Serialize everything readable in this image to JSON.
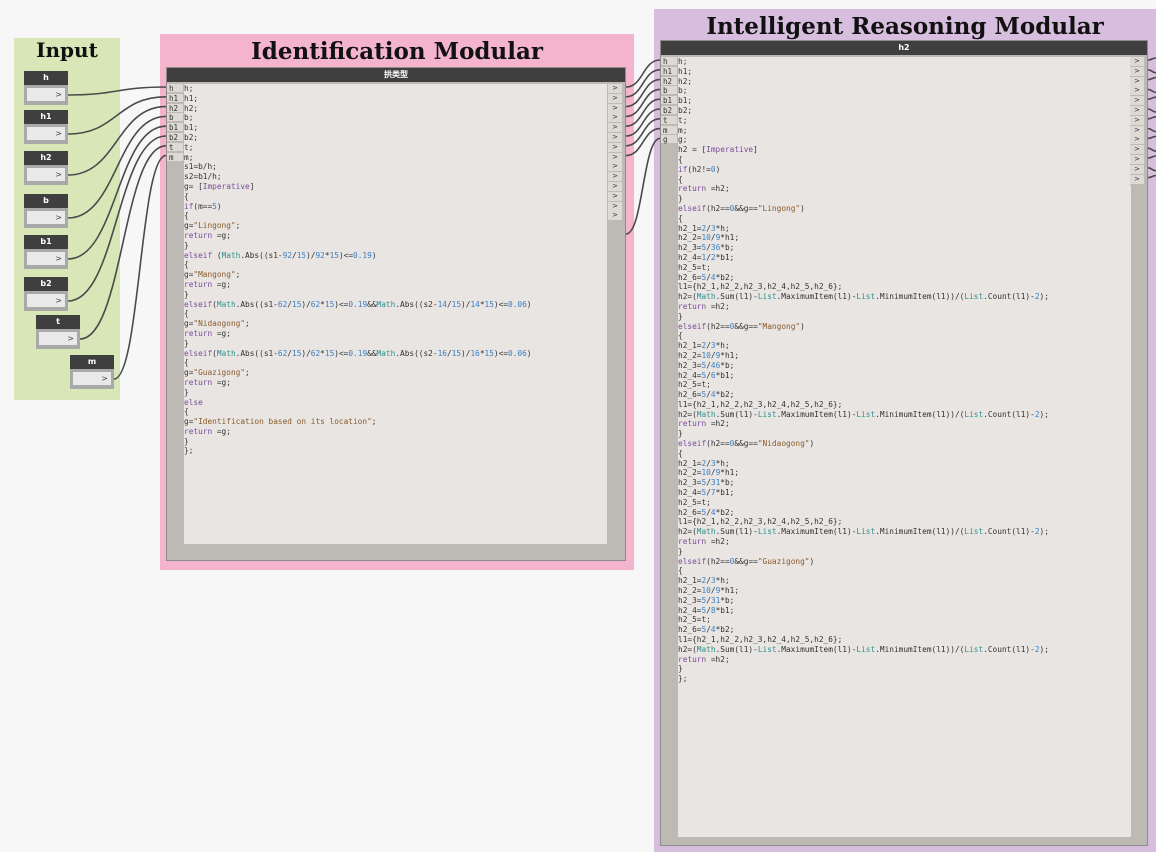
{
  "groups": {
    "input": {
      "title": "Input"
    },
    "identification": {
      "title": "Identification Modular"
    },
    "reasoning": {
      "title": "Intelligent Reasoning Modular"
    }
  },
  "input_nodes": [
    {
      "label": "h",
      "value": ">"
    },
    {
      "label": "h1",
      "value": ">"
    },
    {
      "label": "h2",
      "value": ">"
    },
    {
      "label": "b",
      "value": ">"
    },
    {
      "label": "b1",
      "value": ">"
    },
    {
      "label": "b2",
      "value": ">"
    },
    {
      "label": "t",
      "value": ">"
    },
    {
      "label": "m",
      "value": ">"
    }
  ],
  "ident_node": {
    "title": "拱类型",
    "inputs": [
      "h",
      "h1",
      "h2",
      "b",
      "b1",
      "b2",
      "t",
      "m"
    ],
    "output_count": 14,
    "code": [
      "h;",
      "h1;",
      "h2;",
      "b;",
      "b1;",
      "b2;",
      "t;",
      "m;",
      "s1=b/h;",
      "s2=b1/h;",
      "g= [Imperative]",
      "{",
      "if(m==5)",
      "{",
      "g=\"Lingong\";",
      "return =g;",
      "}",
      "elseif (Math.Abs((s1-92/15)/92*15)<=0.19)",
      "{",
      "g=\"Mangong\";",
      "return =g;",
      "}",
      "elseif(Math.Abs((s1-62/15)/62*15)<=0.19&&Math.Abs((s2-14/15)/14*15)<=0.06)",
      "{",
      "g=\"Nidaogong\";",
      "return =g;",
      "}",
      "elseif(Math.Abs((s1-62/15)/62*15)<=0.19&&Math.Abs((s2-16/15)/16*15)<=0.06)",
      "{",
      "g=\"Guazigong\";",
      "return =g;",
      "}",
      "else",
      "{",
      "g=\"Identification based on its location\";",
      "return =g;",
      "}",
      "};"
    ]
  },
  "reason_node": {
    "title": "h2",
    "inputs": [
      "h",
      "h1",
      "h2",
      "b",
      "b1",
      "b2",
      "t",
      "m",
      "g"
    ],
    "output_count": 13,
    "code": [
      "h;",
      "h1;",
      "h2;",
      "b;",
      "b1;",
      "b2;",
      "t;",
      "m;",
      "g;",
      "h2 = [Imperative]",
      "{",
      "if(h2!=0)",
      "{",
      "return =h2;",
      "}",
      "elseif(h2==0&&g==\"Lingong\")",
      "{",
      "h2_1=2/3*h;",
      "h2_2=10/9*h1;",
      "h2_3=5/36*b;",
      "h2_4=1/2*b1;",
      "h2_5=t;",
      "h2_6=5/4*b2;",
      "l1={h2_1,h2_2,h2_3,h2_4,h2_5,h2_6};",
      "h2=(Math.Sum(l1)-List.MaximumItem(l1)-List.MinimumItem(l1))/(List.Count(l1)-2);",
      "return =h2;",
      "}",
      "elseif(h2==0&&g==\"Mangong\")",
      "{",
      "h2_1=2/3*h;",
      "h2_2=10/9*h1;",
      "h2_3=5/46*b;",
      "h2_4=5/6*b1;",
      "h2_5=t;",
      "h2_6=5/4*b2;",
      "l1={h2_1,h2_2,h2_3,h2_4,h2_5,h2_6};",
      "h2=(Math.Sum(l1)-List.MaximumItem(l1)-List.MinimumItem(l1))/(List.Count(l1)-2);",
      "return =h2;",
      "}",
      "elseif(h2==0&&g==\"Nidaogong\")",
      "{",
      "h2_1=2/3*h;",
      "h2_2=10/9*h1;",
      "h2_3=5/31*b;",
      "h2_4=5/7*b1;",
      "h2_5=t;",
      "h2_6=5/4*b2;",
      "l1={h2_1,h2_2,h2_3,h2_4,h2_5,h2_6};",
      "h2=(Math.Sum(l1)-List.MaximumItem(l1)-List.MinimumItem(l1))/(List.Count(l1)-2);",
      "return =h2;",
      "}",
      "elseif(h2==0&&g==\"Guazigong\")",
      "{",
      "h2_1=2/3*h;",
      "h2_2=10/9*h1;",
      "h2_3=5/31*b;",
      "h2_4=5/8*b1;",
      "h2_5=t;",
      "h2_6=5/4*b2;",
      "l1={h2_1,h2_2,h2_3,h2_4,h2_5,h2_6};",
      "h2=(Math.Sum(l1)-List.MaximumItem(l1)-List.MinimumItem(l1))/(List.Count(l1)-2);",
      "return =h2;",
      "}",
      "};"
    ]
  },
  "colors": {
    "input_group": "#d9e6b8",
    "identification_group": "#f4b4cd",
    "reasoning_group": "#d7bedf",
    "node_header": "#3f3f3f",
    "wire": "#4a4a4a"
  }
}
